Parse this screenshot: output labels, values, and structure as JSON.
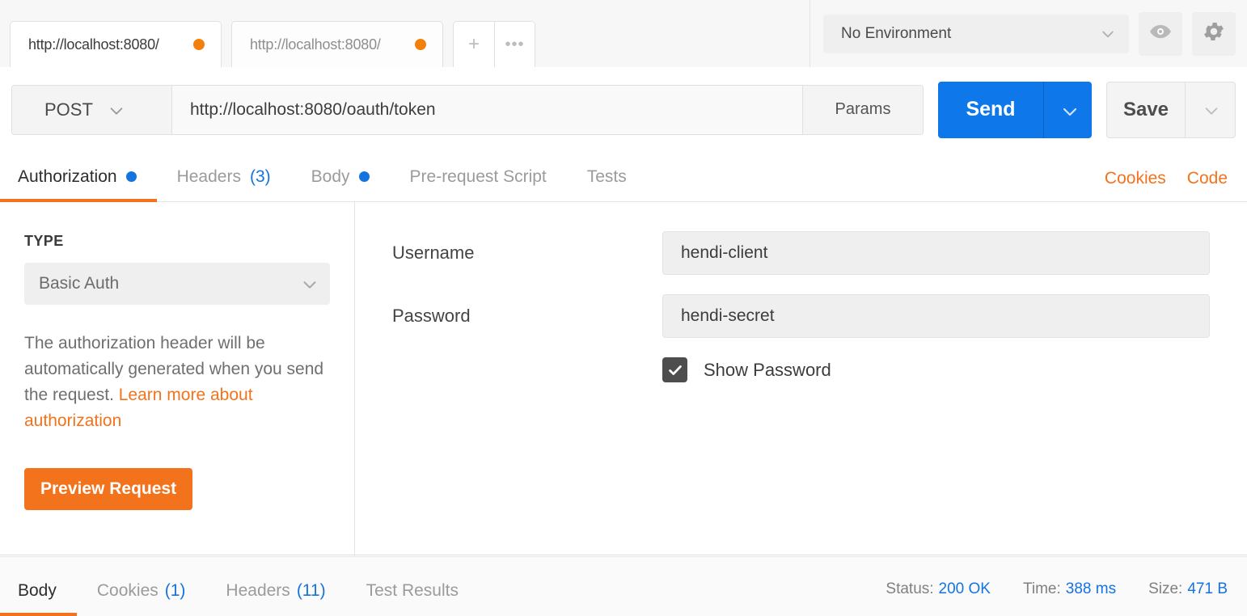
{
  "tabstrip": {
    "tabs": [
      {
        "label": "http://localhost:8080/",
        "active": true,
        "unsaved": true
      },
      {
        "label": "http://localhost:8080/",
        "active": false,
        "unsaved": true
      }
    ],
    "new_tab_icon": "plus-icon",
    "more_icon": "ellipsis-icon"
  },
  "environment": {
    "selected": "No Environment",
    "eye_icon": "eye-icon",
    "settings_icon": "gear-icon"
  },
  "request": {
    "method": "POST",
    "url": "http://localhost:8080/oauth/token",
    "params_label": "Params",
    "send_label": "Send",
    "save_label": "Save"
  },
  "request_tabs": [
    {
      "label": "Authorization",
      "badge_dot": true,
      "active": true
    },
    {
      "label": "Headers",
      "count": "(3)",
      "active": false
    },
    {
      "label": "Body",
      "badge_dot": true,
      "active": false
    },
    {
      "label": "Pre-request Script",
      "active": false
    },
    {
      "label": "Tests",
      "active": false
    }
  ],
  "request_tabs_right": {
    "cookies_label": "Cookies",
    "code_label": "Code"
  },
  "authorization": {
    "type_heading": "TYPE",
    "type_selected": "Basic Auth",
    "description_text": "The authorization header will be automatically generated when you send the request. ",
    "description_link": "Learn more about authorization",
    "preview_label": "Preview Request",
    "username_label": "Username",
    "username_value": "hendi-client",
    "password_label": "Password",
    "password_value": "hendi-secret",
    "show_password_label": "Show Password",
    "show_password_checked": true
  },
  "response_tabs": [
    {
      "label": "Body",
      "active": true
    },
    {
      "label": "Cookies",
      "count": "(1)",
      "active": false
    },
    {
      "label": "Headers",
      "count": "(11)",
      "active": false
    },
    {
      "label": "Test Results",
      "active": false
    }
  ],
  "response_meta": {
    "status_label": "Status:",
    "status_value": "200 OK",
    "time_label": "Time:",
    "time_value": "388 ms",
    "size_label": "Size:",
    "size_value": "471 B"
  },
  "colors": {
    "accent_orange": "#f2731c",
    "accent_blue": "#0e77e9",
    "unsaved_dot": "#f2800b"
  }
}
